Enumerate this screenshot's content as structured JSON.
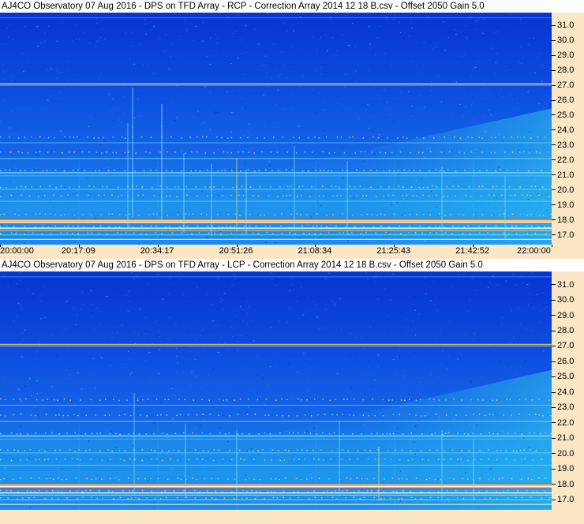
{
  "chart_data": [
    {
      "type": "heatmap",
      "title": "AJ4CO Observatory 07 Aug 2016  -  DPS on TFD Array  -  RCP  -  Correction Array 2014 12 18 B.csv  -  Offset 2050  Gain 5.0",
      "y_ticks": [
        "31.0",
        "30.0",
        "29.0",
        "28.0",
        "27.0",
        "26.0",
        "25.0",
        "24.0",
        "23.0",
        "22.0",
        "21.0",
        "20.0",
        "19.0",
        "18.0",
        "17.0"
      ],
      "ylim": [
        16.4,
        31.9
      ],
      "x_ticks": [
        "20:00:00",
        "20:17:09",
        "20:34:17",
        "20:51:26",
        "21:08:34",
        "21:25:43",
        "21:42:52",
        "22:00:00"
      ],
      "xlim": [
        "20:00:00",
        "22:00:00"
      ]
    },
    {
      "type": "heatmap",
      "title": "AJ4CO Observatory 07 Aug 2016  -  DPS on TFD Array  -  LCP  -  Correction Array 2014 12 18 B.csv  -  Offset 2050  Gain 5.0",
      "y_ticks": [
        "31.0",
        "30.0",
        "29.0",
        "28.0",
        "27.0",
        "26.0",
        "25.0",
        "24.0",
        "23.0",
        "22.0",
        "21.0",
        "20.0",
        "19.0",
        "18.0",
        "17.0"
      ],
      "ylim": [
        16.4,
        31.9
      ],
      "x_ticks": [],
      "xlim": [
        "20:00:00",
        "22:00:00"
      ]
    }
  ],
  "colors": {
    "background": "#fbe7c6",
    "deep_blue": "#0a3fd8",
    "mid_blue": "#1e7de8",
    "cyan": "#2fd6f0",
    "interference_red": "#ff3030",
    "white_band": "#ffffff"
  }
}
